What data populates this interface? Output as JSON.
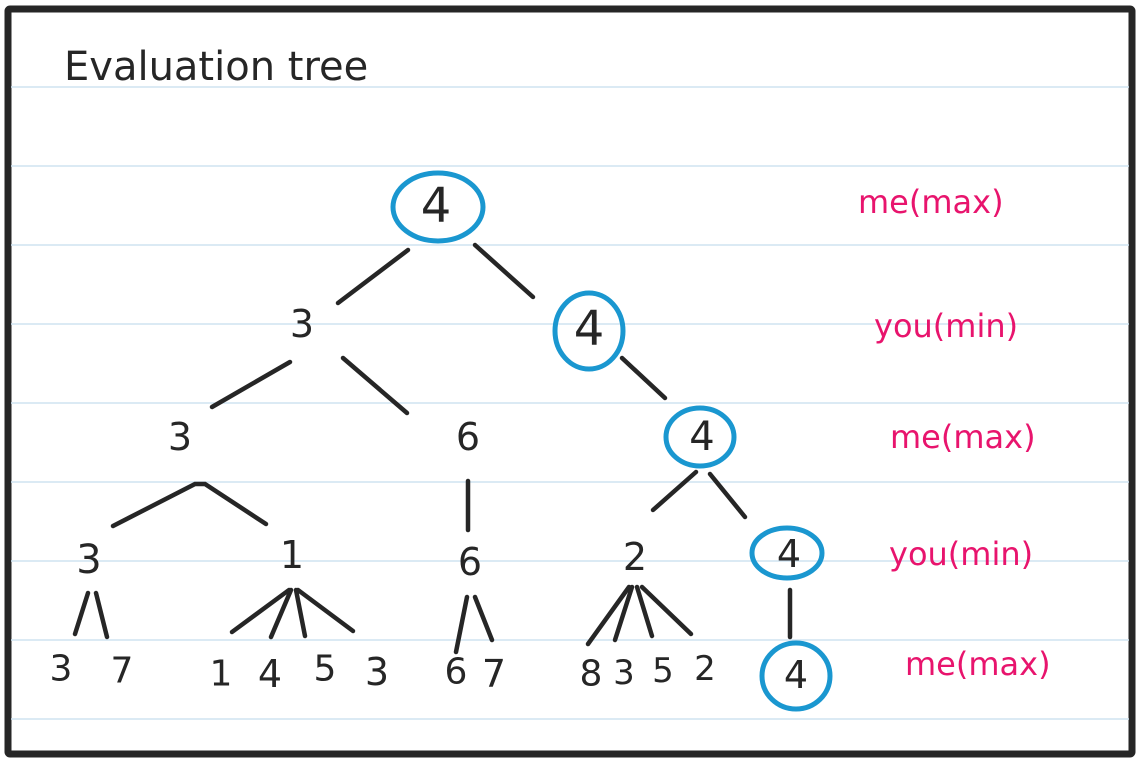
{
  "title": "Evaluation tree",
  "colors": {
    "ink": "#262626",
    "highlight": "#1a97d0",
    "label": "#e8146d",
    "ruled_line": "#cfe3f1"
  },
  "levels": [
    "me(max)",
    "you(min)",
    "me(max)",
    "you(min)",
    "me(max)"
  ],
  "tree": {
    "root": "4",
    "depth1": [
      "3",
      "4"
    ],
    "depth2": [
      "3",
      "6",
      "4"
    ],
    "depth3": [
      "3",
      "1",
      "6",
      "2",
      "4"
    ],
    "leaves": [
      "3",
      "7",
      "1",
      "4",
      "5",
      "3",
      "6",
      "7",
      "8",
      "3",
      "5",
      "2",
      "4"
    ],
    "highlighted_path": [
      "4",
      "4",
      "4",
      "4",
      "4"
    ]
  }
}
